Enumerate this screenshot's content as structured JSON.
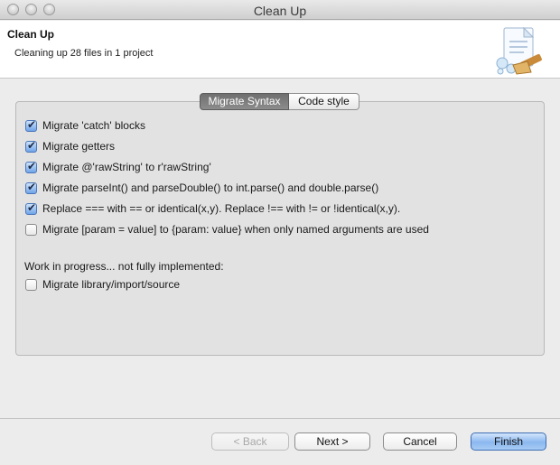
{
  "window": {
    "title": "Clean Up"
  },
  "header": {
    "title": "Clean Up",
    "description": "Cleaning up 28 files in 1 project",
    "icon": "clean-up-brush-document-icon"
  },
  "tabs": [
    {
      "label": "Migrate Syntax",
      "active": true
    },
    {
      "label": "Code style",
      "active": false
    }
  ],
  "options": [
    {
      "label": "Migrate 'catch' blocks",
      "checked": true
    },
    {
      "label": "Migrate getters",
      "checked": true
    },
    {
      "label": "Migrate @'rawString' to r'rawString'",
      "checked": true
    },
    {
      "label": "Migrate parseInt() and parseDouble() to int.parse() and double.parse()",
      "checked": true
    },
    {
      "label": "Replace === with == or identical(x,y). Replace !== with != or !identical(x,y).",
      "checked": true
    },
    {
      "label": "Migrate [param = value] to {param: value} when only named arguments are used",
      "checked": false
    }
  ],
  "wip": {
    "label": "Work in progress... not fully implemented:",
    "options": [
      {
        "label": "Migrate library/import/source",
        "checked": false
      }
    ]
  },
  "buttons": {
    "back": "< Back",
    "next": "Next >",
    "cancel": "Cancel",
    "finish": "Finish"
  },
  "colors": {
    "accent": "#6fa4e8",
    "default_button": "#8bb8ef",
    "active_tab": "#7a7a7a"
  }
}
